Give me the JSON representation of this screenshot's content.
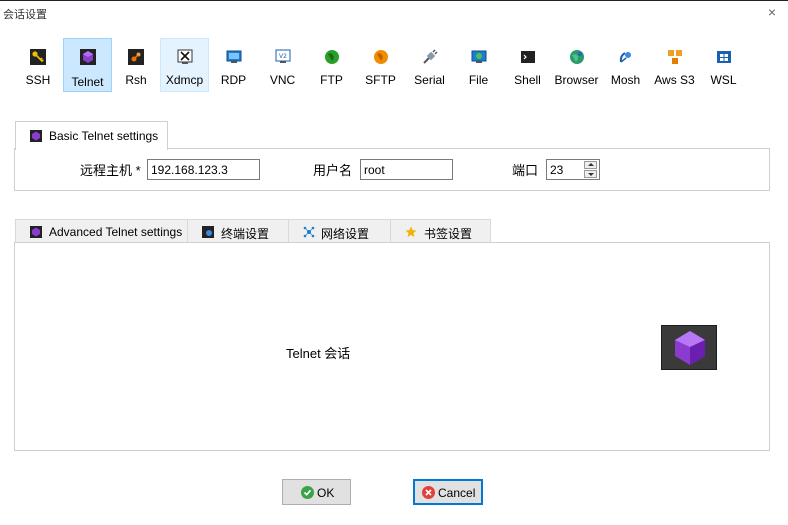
{
  "window": {
    "title": "会话设置",
    "close_glyph": "×"
  },
  "protocols": [
    {
      "id": "ssh",
      "label": "SSH",
      "icon": "key-icon",
      "color": "#e0a800"
    },
    {
      "id": "telnet",
      "label": "Telnet",
      "icon": "telnet-gem-icon",
      "color": "#8a3ccf",
      "state": "selected"
    },
    {
      "id": "rsh",
      "label": "Rsh",
      "icon": "rsh-icon",
      "color": "#e07000"
    },
    {
      "id": "xdmcp",
      "label": "Xdmcp",
      "icon": "x-display-icon",
      "color": "#333333",
      "state": "hover"
    },
    {
      "id": "rdp",
      "label": "RDP",
      "icon": "monitor-icon",
      "color": "#1a7fd1"
    },
    {
      "id": "vnc",
      "label": "VNC",
      "icon": "vnc-icon",
      "color": "#1a7fd1"
    },
    {
      "id": "ftp",
      "label": "FTP",
      "icon": "globe-green-icon",
      "color": "#2aa02a"
    },
    {
      "id": "sftp",
      "label": "SFTP",
      "icon": "globe-orange-icon",
      "color": "#f08c00"
    },
    {
      "id": "serial",
      "label": "Serial",
      "icon": "plug-icon",
      "color": "#6a7a8a"
    },
    {
      "id": "file",
      "label": "File",
      "icon": "file-monitor-icon",
      "color": "#1a7fd1"
    },
    {
      "id": "shell",
      "label": "Shell",
      "icon": "terminal-icon",
      "color": "#222222"
    },
    {
      "id": "browser",
      "label": "Browser",
      "icon": "browser-globe-icon",
      "color": "#2a9a6a"
    },
    {
      "id": "mosh",
      "label": "Mosh",
      "icon": "satellite-icon",
      "color": "#1a5fb0"
    },
    {
      "id": "awss3",
      "label": "Aws S3",
      "icon": "cubes-icon",
      "color": "#f0a020"
    },
    {
      "id": "wsl",
      "label": "WSL",
      "icon": "windows-icon",
      "color": "#1a5fb0"
    }
  ],
  "basic": {
    "tab_label": "Basic Telnet settings",
    "host_label": "远程主机 *",
    "host_value": "192.168.123.3",
    "user_label": "用户名",
    "user_value": "root",
    "port_label": "端口",
    "port_value": "23"
  },
  "advanced_tabs": [
    {
      "label": "Advanced Telnet settings",
      "icon": "telnet-gem-icon"
    },
    {
      "label": "终端设置",
      "icon": "terminal-settings-icon"
    },
    {
      "label": "网络设置",
      "icon": "network-icon"
    },
    {
      "label": "书签设置",
      "icon": "star-icon"
    }
  ],
  "session_text": "Telnet 会话",
  "buttons": {
    "ok": "OK",
    "cancel": "Cancel"
  },
  "colors": {
    "accent": "#0078d7",
    "selected_bg": "#cce8ff"
  }
}
